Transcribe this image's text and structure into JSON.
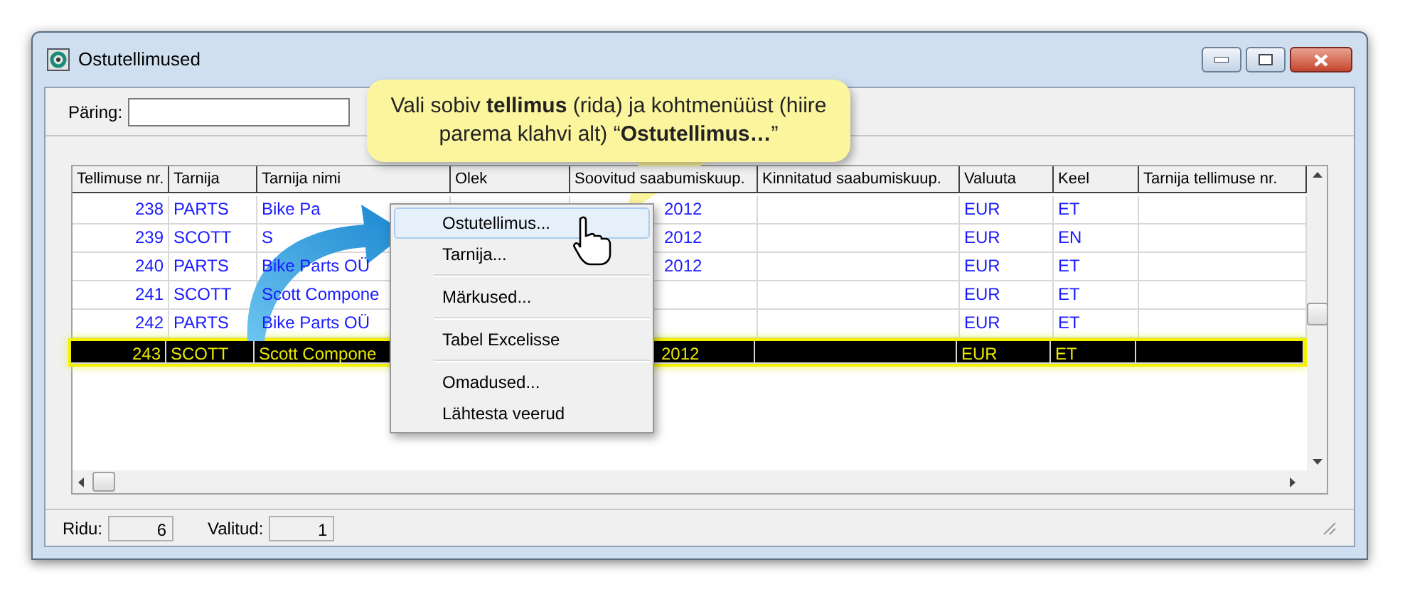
{
  "window": {
    "title": "Ostutellimused"
  },
  "query": {
    "label": "Päring:"
  },
  "callout": {
    "text": "Vali sobiv **tellimus** (rida) ja kohtmenüüst (hiire parema klahvi alt) “**Ostutellimus…**”"
  },
  "table": {
    "columns": [
      "Tellimuse nr.",
      "Tarnija",
      "Tarnija nimi",
      "Olek",
      "Soovitud saabumiskuup.",
      "Kinnitatud saabumiskuup.",
      "Valuuta",
      "Keel",
      "Tarnija tellimuse nr."
    ],
    "rows": [
      {
        "cells": [
          "238",
          "PARTS",
          "Bike Pa",
          "",
          "2012",
          "",
          "EUR",
          "ET",
          ""
        ],
        "selected": false
      },
      {
        "cells": [
          "239",
          "SCOTT",
          "S",
          "",
          "2012",
          "",
          "EUR",
          "EN",
          ""
        ],
        "selected": false
      },
      {
        "cells": [
          "240",
          "PARTS",
          "Bike Parts OÜ",
          "",
          "2012",
          "",
          "EUR",
          "ET",
          ""
        ],
        "selected": false
      },
      {
        "cells": [
          "241",
          "SCOTT",
          "Scott Compone",
          "",
          "",
          "",
          "EUR",
          "ET",
          ""
        ],
        "selected": false
      },
      {
        "cells": [
          "242",
          "PARTS",
          "Bike Parts OÜ",
          "",
          "",
          "",
          "EUR",
          "ET",
          ""
        ],
        "selected": false
      },
      {
        "cells": [
          "243",
          "SCOTT",
          "Scott Compone",
          "",
          "2012",
          "",
          "EUR",
          "ET",
          ""
        ],
        "selected": true
      }
    ]
  },
  "context_menu": {
    "groups": [
      [
        {
          "label": "Ostutellimus...",
          "selected": true
        },
        {
          "label": "Tarnija...",
          "selected": false
        }
      ],
      [
        {
          "label": "Märkused...",
          "selected": false
        }
      ],
      [
        {
          "label": "Tabel Excelisse",
          "selected": false
        }
      ],
      [
        {
          "label": "Omadused...",
          "selected": false
        },
        {
          "label": "Lähtesta veerud",
          "selected": false
        }
      ]
    ]
  },
  "status_bar": {
    "rows_label": "Ridu:",
    "rows_value": "6",
    "selected_label": "Valitud:",
    "selected_value": "1"
  }
}
